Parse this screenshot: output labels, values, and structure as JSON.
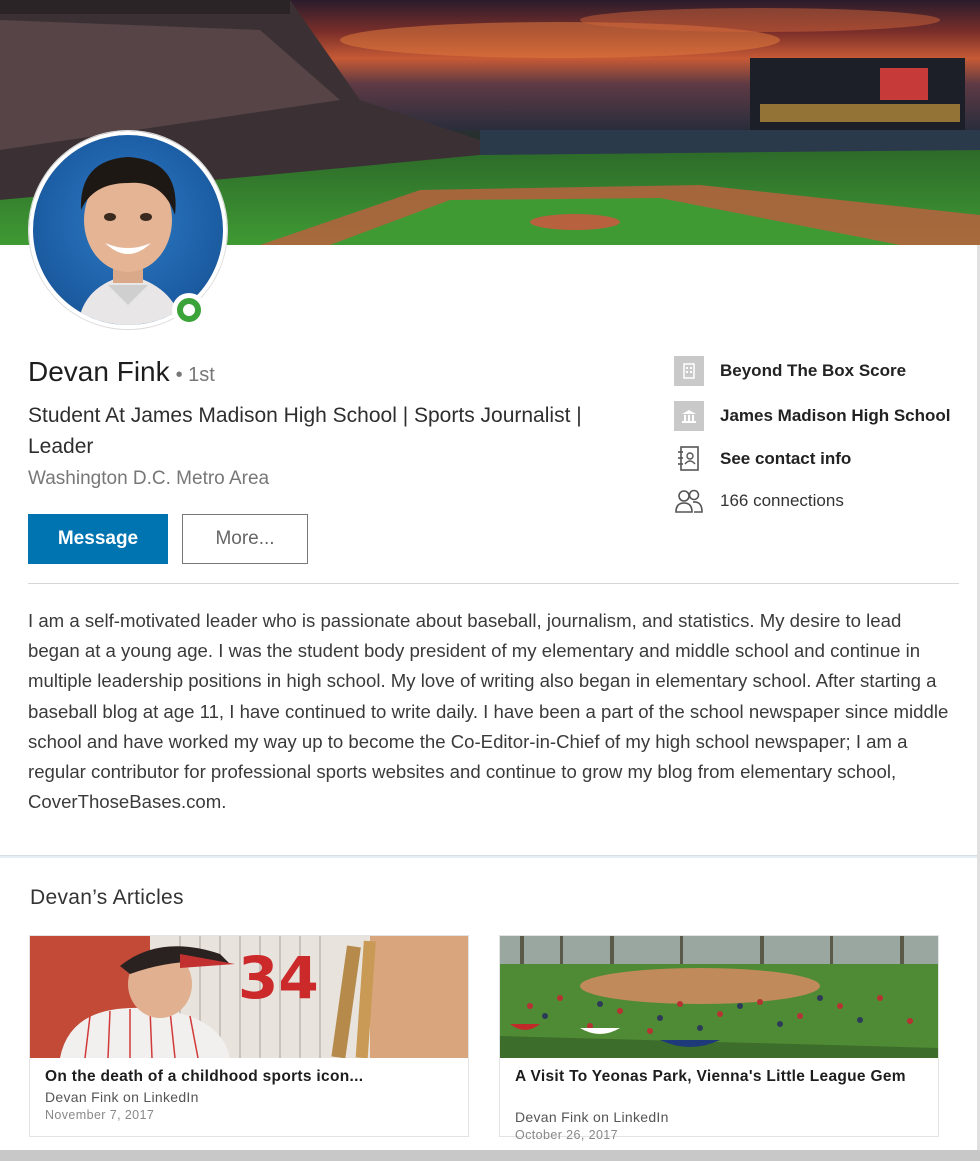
{
  "profile": {
    "name": "Devan Fink",
    "degree": "• 1st",
    "headline": "Student At James Madison High School | Sports Journalist | Leader",
    "location": "Washington D.C. Metro Area",
    "buttons": {
      "message": "Message",
      "more": "More..."
    },
    "status": "online"
  },
  "info": {
    "company": "Beyond The Box Score",
    "school": "James Madison High School",
    "contact": "See contact info",
    "connections": "166 connections"
  },
  "summary": "I am a self-motivated leader who is passionate about baseball, journalism, and statistics. My desire to lead began at a young age. I was the student body president of my elementary and middle school and continue in multiple leadership positions in high school. My love of writing also began in elementary school. After starting a baseball blog at age 11, I have continued to write daily. I have been a part of the school newspaper since middle school and have worked my way up to become the Co-Editor-in-Chief of my high school newspaper; I am a regular contributor for professional sports websites and continue to grow my blog from elementary school, CoverThoseBases.com.",
  "articles": {
    "heading": "Devan’s Articles",
    "items": [
      {
        "title": "On the death of a childhood sports icon...",
        "author": "Devan Fink on LinkedIn",
        "date": "November 7, 2017"
      },
      {
        "title": "A Visit To Yeonas Park, Vienna's Little League Gem",
        "author": "Devan Fink on LinkedIn",
        "date": "October 26, 2017"
      }
    ]
  },
  "colors": {
    "primary": "#0073b1",
    "online": "#3aa43a"
  },
  "icons": {
    "company": "company-logo-icon",
    "school": "school-logo-icon",
    "contact": "contact-card-icon",
    "connections": "people-icon"
  }
}
